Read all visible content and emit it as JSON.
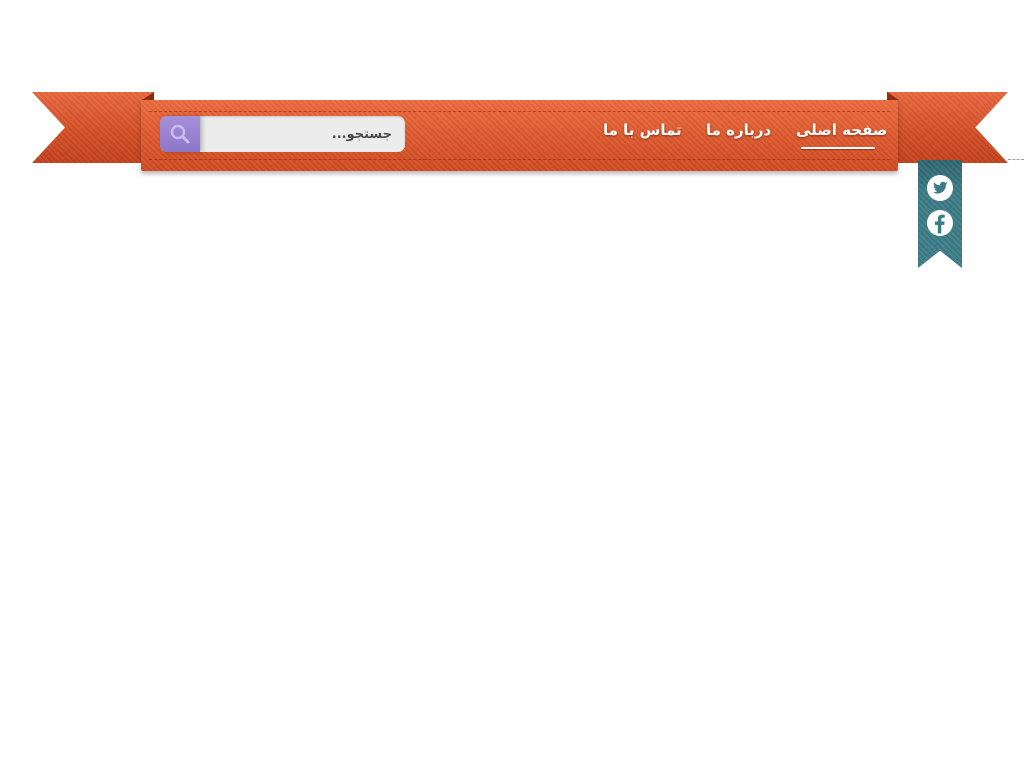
{
  "nav": {
    "items": [
      {
        "label": "صفحه اصلی",
        "active": true
      },
      {
        "label": "درباره ما",
        "active": false
      },
      {
        "label": "تماس با ما",
        "active": false
      }
    ]
  },
  "search": {
    "placeholder": "جستجو...",
    "button_icon": "search-icon"
  },
  "social": {
    "icons": [
      "twitter-icon",
      "facebook-icon"
    ]
  },
  "colors": {
    "ribbon": "#de5a2f",
    "ribbon_dark": "#c2421d",
    "social_ribbon": "#3b7b86",
    "search_button": "#9a84d0",
    "search_field": "#ececec"
  }
}
